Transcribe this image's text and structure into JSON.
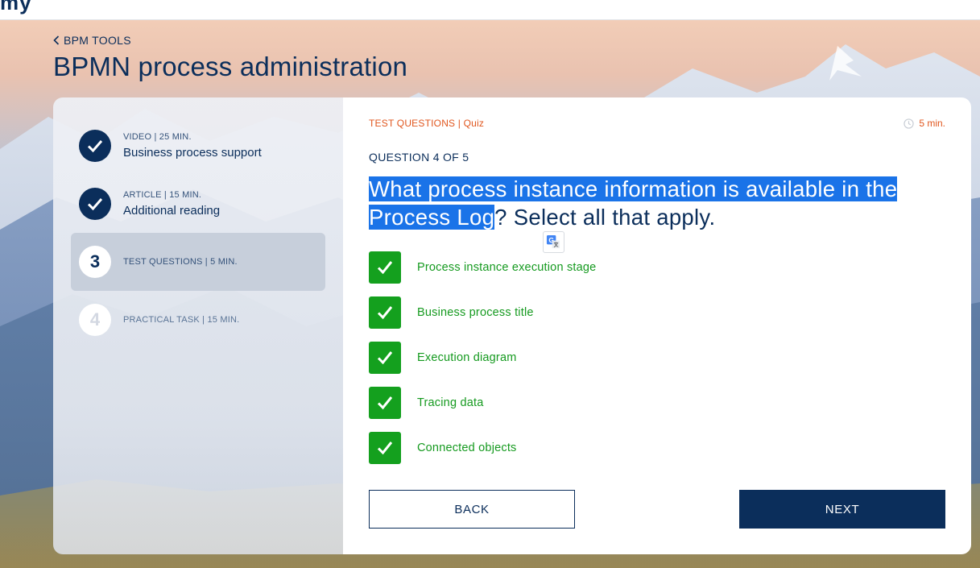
{
  "header": {
    "logo_fragment": "my"
  },
  "nav": {
    "back_label": "BPM TOOLS"
  },
  "page": {
    "title": "BPMN process administration"
  },
  "steps": [
    {
      "kind": "VIDEO | 25 MIN.",
      "name": "Business process support",
      "state": "done",
      "icon": "check-icon"
    },
    {
      "kind": "ARTICLE | 15 MIN.",
      "name": "Additional reading",
      "state": "done",
      "icon": "check-icon"
    },
    {
      "number": "3",
      "kind": "TEST QUESTIONS | 5 MIN.",
      "state": "current"
    },
    {
      "number": "4",
      "kind": "PRACTICAL TASK | 15 MIN.",
      "state": "todo"
    }
  ],
  "quiz": {
    "breadcrumb": "TEST QUESTIONS | Quiz",
    "time": "5 min.",
    "question_counter": "QUESTION 4 OF 5",
    "question_highlighted": "What process instance information is available in the Process Log",
    "question_rest": "? Select all that apply.",
    "answers": [
      {
        "label": "Process instance execution stage",
        "checked": true
      },
      {
        "label": "Business process title",
        "checked": true
      },
      {
        "label": "Execution diagram",
        "checked": true
      },
      {
        "label": "Tracing data",
        "checked": true
      },
      {
        "label": "Connected objects",
        "checked": true
      }
    ],
    "back_button": "BACK",
    "next_button": "NEXT"
  },
  "colors": {
    "brand_navy": "#0b2e5b",
    "accent_orange": "#e0561e",
    "check_green": "#14a01e",
    "selection_blue": "#1a73e8"
  }
}
